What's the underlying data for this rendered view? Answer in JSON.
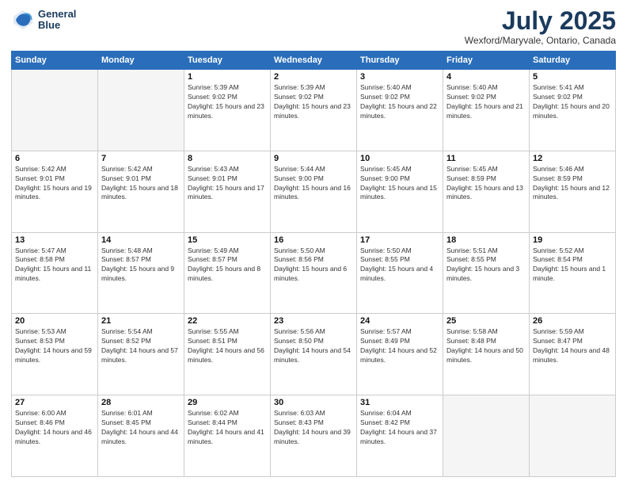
{
  "header": {
    "logo_line1": "General",
    "logo_line2": "Blue",
    "month": "July 2025",
    "location": "Wexford/Maryvale, Ontario, Canada"
  },
  "days_of_week": [
    "Sunday",
    "Monday",
    "Tuesday",
    "Wednesday",
    "Thursday",
    "Friday",
    "Saturday"
  ],
  "weeks": [
    [
      {
        "day": "",
        "sunrise": "",
        "sunset": "",
        "daylight": ""
      },
      {
        "day": "",
        "sunrise": "",
        "sunset": "",
        "daylight": ""
      },
      {
        "day": "1",
        "sunrise": "Sunrise: 5:39 AM",
        "sunset": "Sunset: 9:02 PM",
        "daylight": "Daylight: 15 hours and 23 minutes."
      },
      {
        "day": "2",
        "sunrise": "Sunrise: 5:39 AM",
        "sunset": "Sunset: 9:02 PM",
        "daylight": "Daylight: 15 hours and 23 minutes."
      },
      {
        "day": "3",
        "sunrise": "Sunrise: 5:40 AM",
        "sunset": "Sunset: 9:02 PM",
        "daylight": "Daylight: 15 hours and 22 minutes."
      },
      {
        "day": "4",
        "sunrise": "Sunrise: 5:40 AM",
        "sunset": "Sunset: 9:02 PM",
        "daylight": "Daylight: 15 hours and 21 minutes."
      },
      {
        "day": "5",
        "sunrise": "Sunrise: 5:41 AM",
        "sunset": "Sunset: 9:02 PM",
        "daylight": "Daylight: 15 hours and 20 minutes."
      }
    ],
    [
      {
        "day": "6",
        "sunrise": "Sunrise: 5:42 AM",
        "sunset": "Sunset: 9:01 PM",
        "daylight": "Daylight: 15 hours and 19 minutes."
      },
      {
        "day": "7",
        "sunrise": "Sunrise: 5:42 AM",
        "sunset": "Sunset: 9:01 PM",
        "daylight": "Daylight: 15 hours and 18 minutes."
      },
      {
        "day": "8",
        "sunrise": "Sunrise: 5:43 AM",
        "sunset": "Sunset: 9:01 PM",
        "daylight": "Daylight: 15 hours and 17 minutes."
      },
      {
        "day": "9",
        "sunrise": "Sunrise: 5:44 AM",
        "sunset": "Sunset: 9:00 PM",
        "daylight": "Daylight: 15 hours and 16 minutes."
      },
      {
        "day": "10",
        "sunrise": "Sunrise: 5:45 AM",
        "sunset": "Sunset: 9:00 PM",
        "daylight": "Daylight: 15 hours and 15 minutes."
      },
      {
        "day": "11",
        "sunrise": "Sunrise: 5:45 AM",
        "sunset": "Sunset: 8:59 PM",
        "daylight": "Daylight: 15 hours and 13 minutes."
      },
      {
        "day": "12",
        "sunrise": "Sunrise: 5:46 AM",
        "sunset": "Sunset: 8:59 PM",
        "daylight": "Daylight: 15 hours and 12 minutes."
      }
    ],
    [
      {
        "day": "13",
        "sunrise": "Sunrise: 5:47 AM",
        "sunset": "Sunset: 8:58 PM",
        "daylight": "Daylight: 15 hours and 11 minutes."
      },
      {
        "day": "14",
        "sunrise": "Sunrise: 5:48 AM",
        "sunset": "Sunset: 8:57 PM",
        "daylight": "Daylight: 15 hours and 9 minutes."
      },
      {
        "day": "15",
        "sunrise": "Sunrise: 5:49 AM",
        "sunset": "Sunset: 8:57 PM",
        "daylight": "Daylight: 15 hours and 8 minutes."
      },
      {
        "day": "16",
        "sunrise": "Sunrise: 5:50 AM",
        "sunset": "Sunset: 8:56 PM",
        "daylight": "Daylight: 15 hours and 6 minutes."
      },
      {
        "day": "17",
        "sunrise": "Sunrise: 5:50 AM",
        "sunset": "Sunset: 8:55 PM",
        "daylight": "Daylight: 15 hours and 4 minutes."
      },
      {
        "day": "18",
        "sunrise": "Sunrise: 5:51 AM",
        "sunset": "Sunset: 8:55 PM",
        "daylight": "Daylight: 15 hours and 3 minutes."
      },
      {
        "day": "19",
        "sunrise": "Sunrise: 5:52 AM",
        "sunset": "Sunset: 8:54 PM",
        "daylight": "Daylight: 15 hours and 1 minute."
      }
    ],
    [
      {
        "day": "20",
        "sunrise": "Sunrise: 5:53 AM",
        "sunset": "Sunset: 8:53 PM",
        "daylight": "Daylight: 14 hours and 59 minutes."
      },
      {
        "day": "21",
        "sunrise": "Sunrise: 5:54 AM",
        "sunset": "Sunset: 8:52 PM",
        "daylight": "Daylight: 14 hours and 57 minutes."
      },
      {
        "day": "22",
        "sunrise": "Sunrise: 5:55 AM",
        "sunset": "Sunset: 8:51 PM",
        "daylight": "Daylight: 14 hours and 56 minutes."
      },
      {
        "day": "23",
        "sunrise": "Sunrise: 5:56 AM",
        "sunset": "Sunset: 8:50 PM",
        "daylight": "Daylight: 14 hours and 54 minutes."
      },
      {
        "day": "24",
        "sunrise": "Sunrise: 5:57 AM",
        "sunset": "Sunset: 8:49 PM",
        "daylight": "Daylight: 14 hours and 52 minutes."
      },
      {
        "day": "25",
        "sunrise": "Sunrise: 5:58 AM",
        "sunset": "Sunset: 8:48 PM",
        "daylight": "Daylight: 14 hours and 50 minutes."
      },
      {
        "day": "26",
        "sunrise": "Sunrise: 5:59 AM",
        "sunset": "Sunset: 8:47 PM",
        "daylight": "Daylight: 14 hours and 48 minutes."
      }
    ],
    [
      {
        "day": "27",
        "sunrise": "Sunrise: 6:00 AM",
        "sunset": "Sunset: 8:46 PM",
        "daylight": "Daylight: 14 hours and 46 minutes."
      },
      {
        "day": "28",
        "sunrise": "Sunrise: 6:01 AM",
        "sunset": "Sunset: 8:45 PM",
        "daylight": "Daylight: 14 hours and 44 minutes."
      },
      {
        "day": "29",
        "sunrise": "Sunrise: 6:02 AM",
        "sunset": "Sunset: 8:44 PM",
        "daylight": "Daylight: 14 hours and 41 minutes."
      },
      {
        "day": "30",
        "sunrise": "Sunrise: 6:03 AM",
        "sunset": "Sunset: 8:43 PM",
        "daylight": "Daylight: 14 hours and 39 minutes."
      },
      {
        "day": "31",
        "sunrise": "Sunrise: 6:04 AM",
        "sunset": "Sunset: 8:42 PM",
        "daylight": "Daylight: 14 hours and 37 minutes."
      },
      {
        "day": "",
        "sunrise": "",
        "sunset": "",
        "daylight": ""
      },
      {
        "day": "",
        "sunrise": "",
        "sunset": "",
        "daylight": ""
      }
    ]
  ]
}
